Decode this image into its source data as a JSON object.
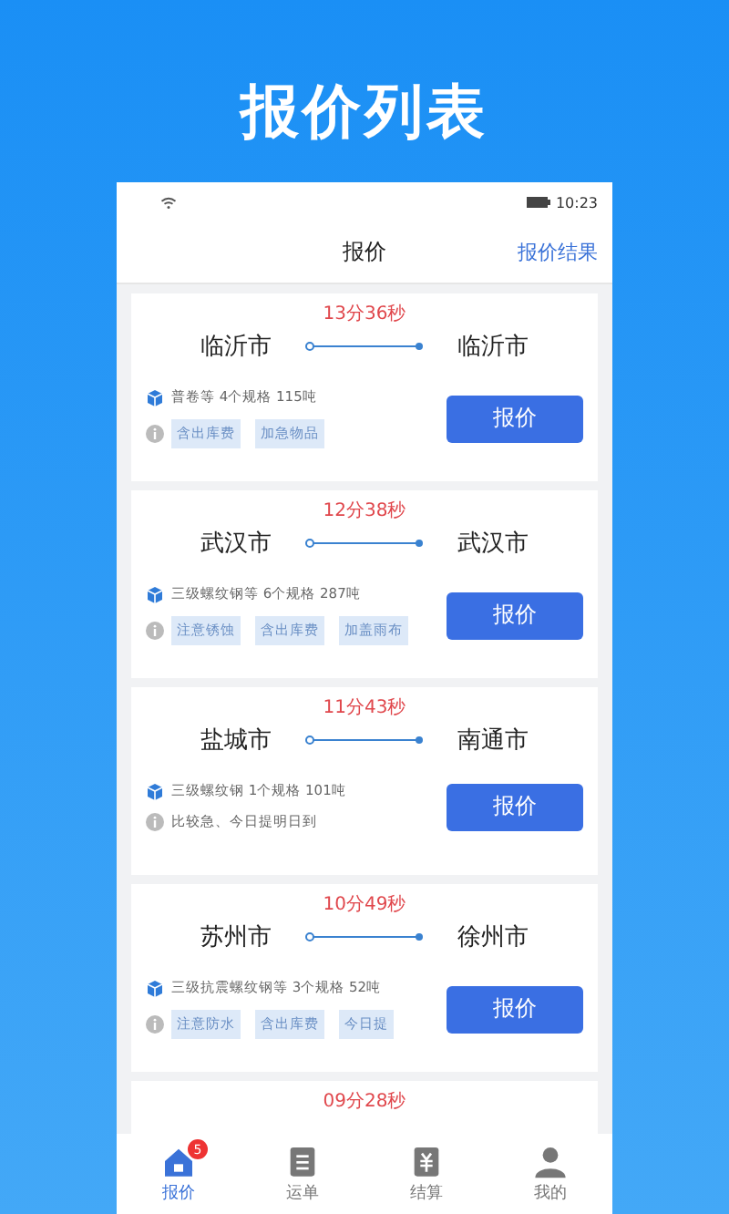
{
  "page_title": "报价列表",
  "status_bar": {
    "time": "10:23"
  },
  "header": {
    "title": "报价",
    "action": "报价结果"
  },
  "quotes": [
    {
      "countdown": "13分36秒",
      "from": "临沂市",
      "to": "临沂市",
      "cargo": "普卷等 4个规格 115吨",
      "kind": "tags",
      "tags": [
        "含出库费",
        "加急物品"
      ],
      "button": "报价"
    },
    {
      "countdown": "12分38秒",
      "from": "武汉市",
      "to": "武汉市",
      "cargo": "三级螺纹钢等 6个规格 287吨",
      "kind": "tags",
      "tags": [
        "注意锈蚀",
        "含出库费",
        "加盖雨布"
      ],
      "button": "报价"
    },
    {
      "countdown": "11分43秒",
      "from": "盐城市",
      "to": "南通市",
      "cargo": "三级螺纹钢 1个规格 101吨",
      "kind": "note",
      "note": "比较急、今日提明日到",
      "button": "报价"
    },
    {
      "countdown": "10分49秒",
      "from": "苏州市",
      "to": "徐州市",
      "cargo": "三级抗震螺纹钢等 3个规格 52吨",
      "kind": "tags",
      "tags": [
        "注意防水",
        "含出库费",
        "今日提"
      ],
      "button": "报价"
    },
    {
      "countdown": "09分28秒",
      "kind": "partial"
    }
  ],
  "tab_bar": [
    {
      "label": "报价",
      "selected": true,
      "badge": "5"
    },
    {
      "label": "运单",
      "selected": false
    },
    {
      "label": "结算",
      "selected": false
    },
    {
      "label": "我的",
      "selected": false
    }
  ]
}
